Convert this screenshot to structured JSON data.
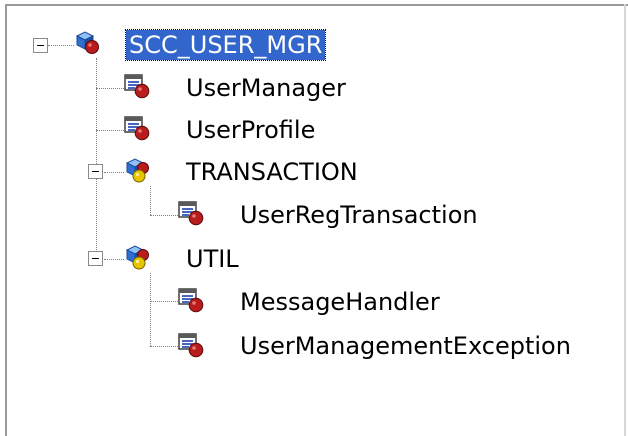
{
  "tree": {
    "root": {
      "label": "SCC_USER_MGR",
      "icon": "package-icon",
      "selected": true,
      "expanded": true
    },
    "items": [
      {
        "label": "UserManager",
        "icon": "class-icon",
        "depth": 1
      },
      {
        "label": "UserProfile",
        "icon": "class-icon",
        "depth": 1
      },
      {
        "label": "TRANSACTION",
        "icon": "subpackage-icon",
        "depth": 1,
        "expanded": true
      },
      {
        "label": "UserRegTransaction",
        "icon": "class-icon",
        "depth": 2
      },
      {
        "label": "UTIL",
        "icon": "subpackage-icon",
        "depth": 1,
        "expanded": true
      },
      {
        "label": "MessageHandler",
        "icon": "class-icon",
        "depth": 2
      },
      {
        "label": "UserManagementException",
        "icon": "class-icon",
        "depth": 2
      }
    ]
  },
  "colors": {
    "selection": "#3366cc",
    "icon_red": "#b81c1c",
    "icon_blue": "#2f6fd0",
    "icon_yellow": "#e8c400"
  }
}
